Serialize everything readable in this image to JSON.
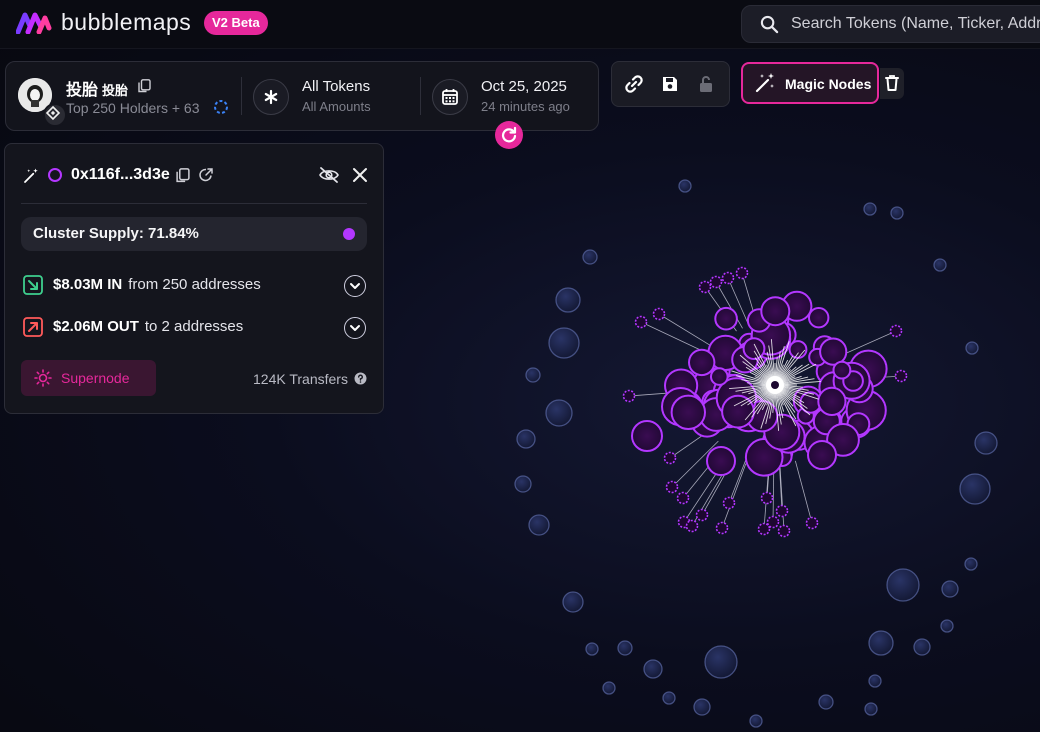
{
  "brand": {
    "name": "bubblemaps",
    "badge": "V2 Beta",
    "accent": "#e6289b"
  },
  "search": {
    "placeholder": "Search Tokens (Name, Ticker, Address)"
  },
  "token": {
    "name": "投胎",
    "ticker": "投胎",
    "holders": "Top 250 Holders + 63",
    "chain_icon": "bnb-chain-icon"
  },
  "filter": {
    "title": "All Tokens",
    "subtitle": "All Amounts"
  },
  "date": {
    "title": "Oct 25, 2025",
    "subtitle": "24 minutes ago"
  },
  "magic_nodes": {
    "label": "Magic Nodes"
  },
  "cluster": {
    "address": "0x116f...3d3e",
    "supply": "Cluster Supply: 71.84%",
    "supply_color": "#b337ff",
    "in_amount": "$8.03M IN",
    "in_detail": "from 250 addresses",
    "out_amount": "$2.06M OUT",
    "out_detail": "to 2 addresses",
    "supernode_label": "Supernode",
    "transfers": "124K Transfers"
  },
  "colors": {
    "cluster": "#b337ff",
    "outer_bubble": "#1a2144",
    "in": "#3ecf8e",
    "out": "#ff5a5a"
  }
}
